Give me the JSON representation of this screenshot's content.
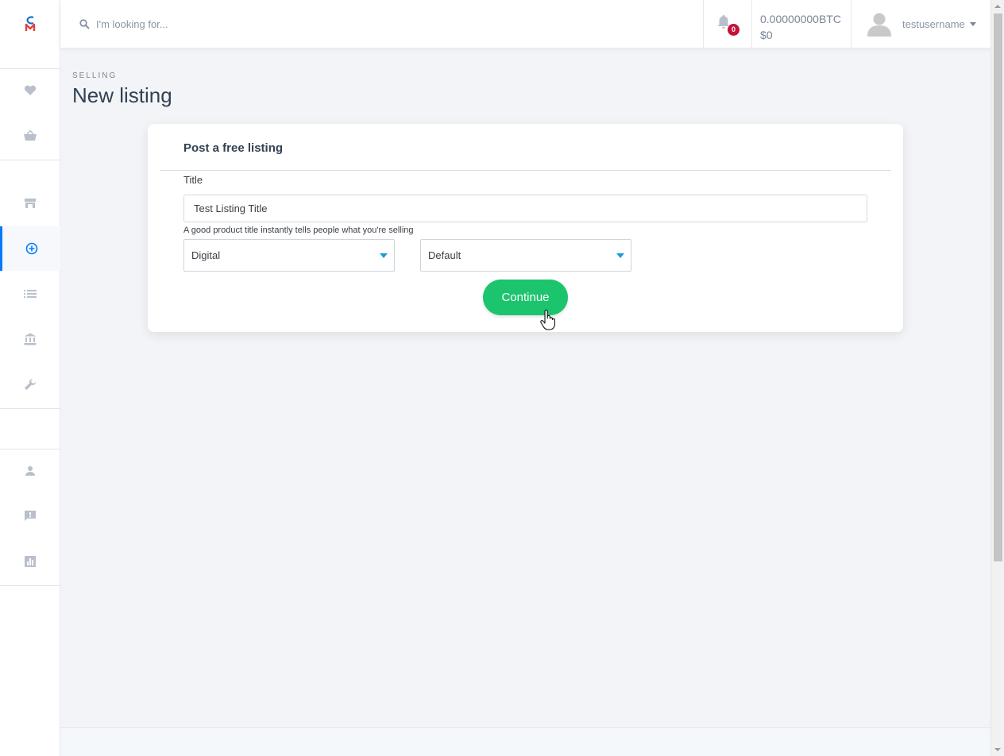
{
  "search": {
    "placeholder": "I'm looking for..."
  },
  "notifications": {
    "count": "0"
  },
  "balance": {
    "btc": "0.00000000BTC",
    "usd": "$0"
  },
  "user": {
    "name": "testusername"
  },
  "page": {
    "breadcrumb": "SELLING",
    "title": "New listing"
  },
  "form": {
    "header": "Post a free listing",
    "title_label": "Title",
    "title_value": "Test Listing Title",
    "help_text": "A good product title instantly tells people what you're selling",
    "type_select": "Digital",
    "category_select": "Default",
    "continue_label": "Continue"
  },
  "sidebar": {
    "items": [
      {
        "icon": "heart-icon"
      },
      {
        "icon": "basket-icon"
      },
      {
        "icon": "store-icon"
      },
      {
        "icon": "plus-circle-icon",
        "active": true
      },
      {
        "icon": "list-icon"
      },
      {
        "icon": "bank-icon"
      },
      {
        "icon": "wrench-icon"
      },
      {
        "icon": "user-icon"
      },
      {
        "icon": "message-icon"
      },
      {
        "icon": "chart-icon"
      }
    ]
  },
  "colors": {
    "accent": "#047bf8",
    "continue": "#1cc46e",
    "badge": "#c5123a",
    "select_arrow": "#1e9bd7"
  }
}
